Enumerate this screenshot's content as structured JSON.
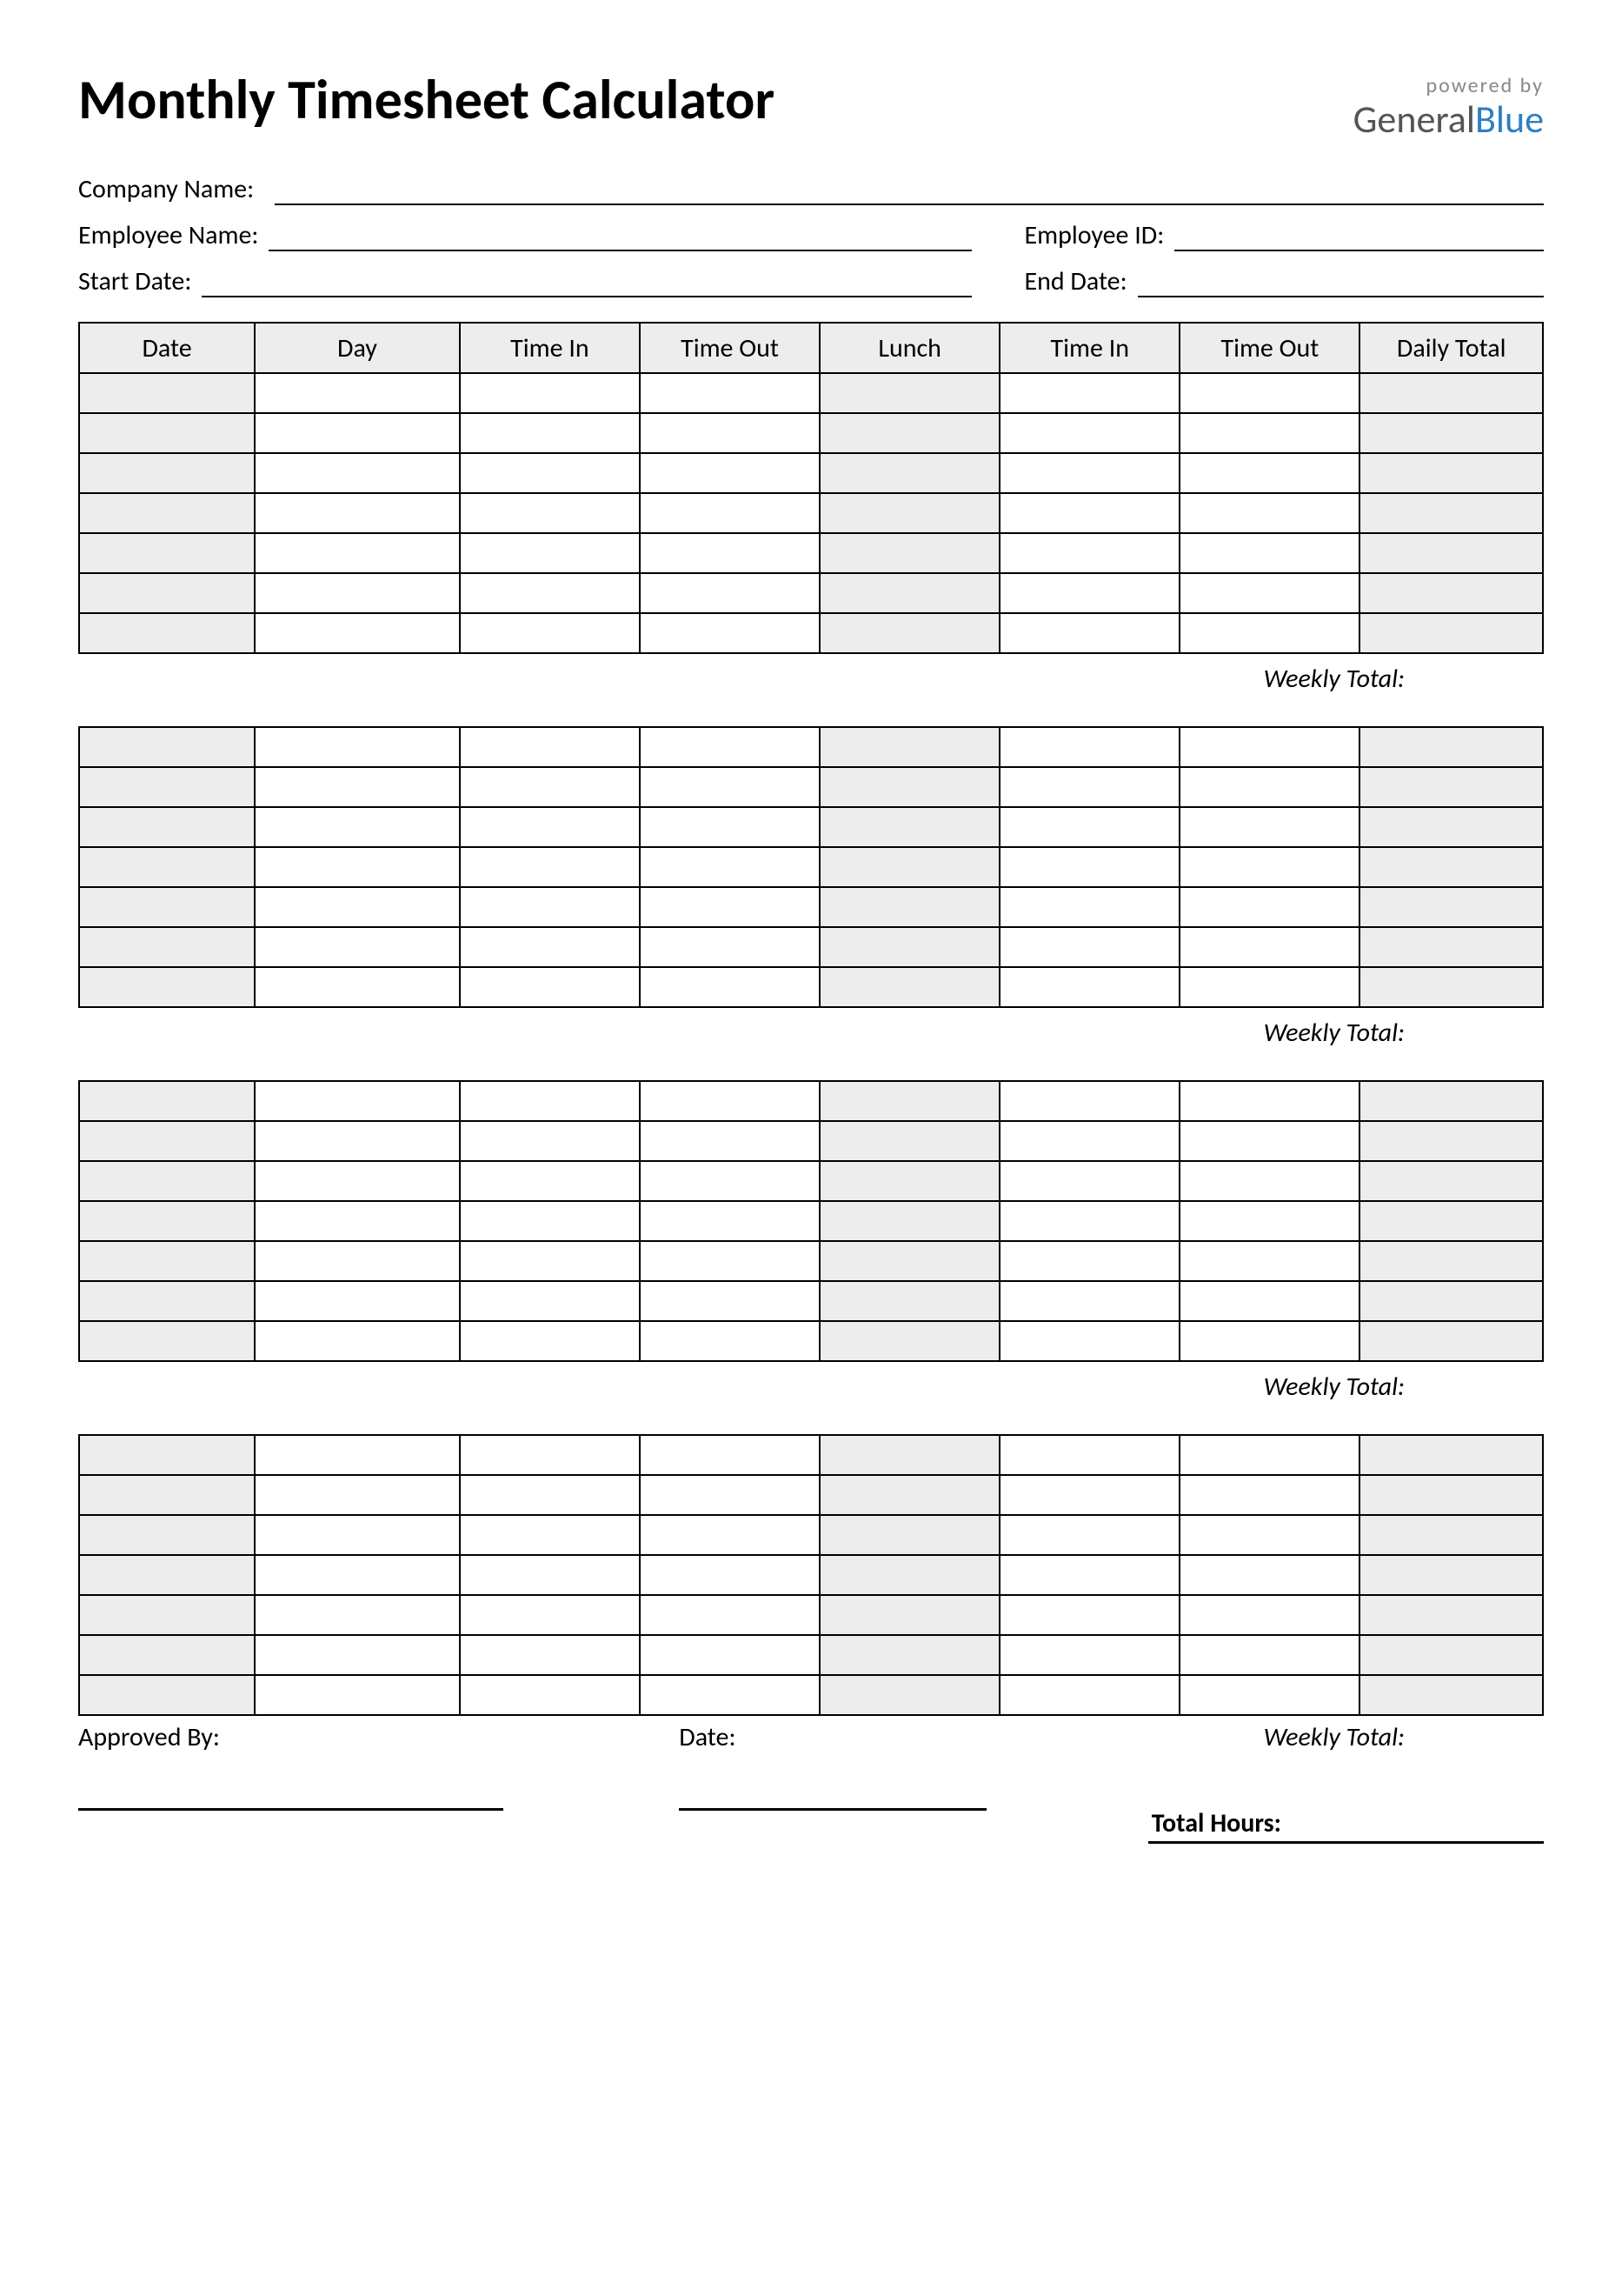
{
  "header": {
    "title": "Monthly Timesheet Calculator",
    "powered_by": "powered by",
    "brand_general": "General",
    "brand_blue": "Blue"
  },
  "info": {
    "company_name_label": "Company Name:",
    "employee_name_label": "Employee Name:",
    "employee_id_label": "Employee ID:",
    "start_date_label": "Start Date:",
    "end_date_label": "End Date:"
  },
  "columns": {
    "date": "Date",
    "day": "Day",
    "time_in": "Time In",
    "time_out": "Time Out",
    "lunch": "Lunch",
    "time_in_2": "Time In",
    "time_out_2": "Time Out",
    "daily_total": "Daily Total"
  },
  "weekly_total_label": "Weekly Total:",
  "footer": {
    "approved_by_label": "Approved By:",
    "date_label": "Date:",
    "total_hours_label": "Total Hours:"
  }
}
